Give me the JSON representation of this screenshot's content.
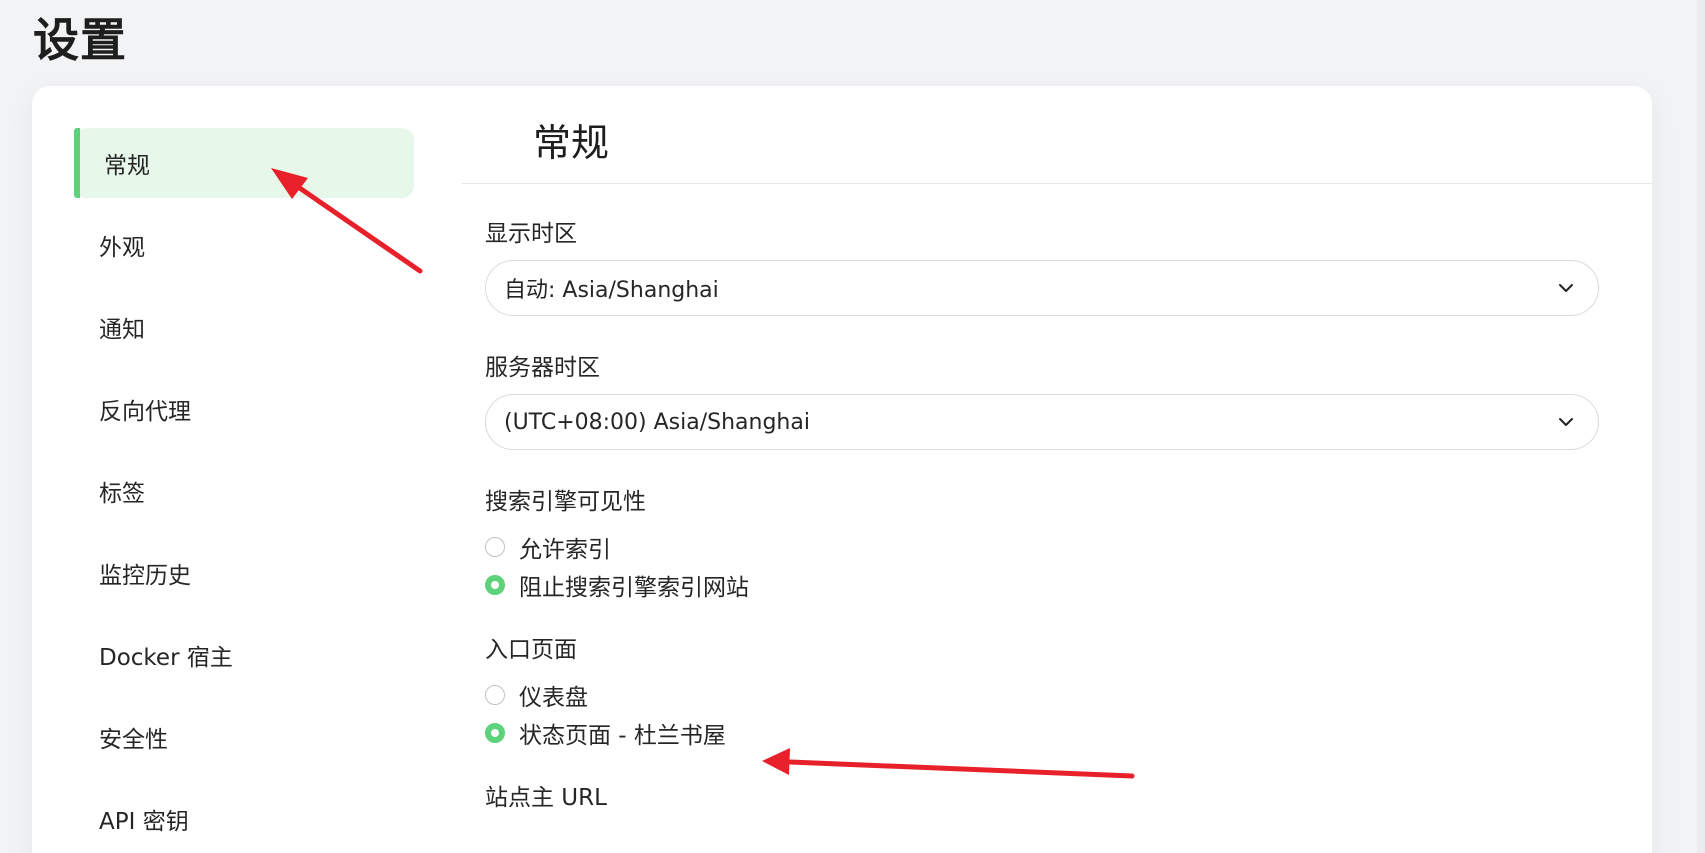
{
  "page": {
    "title": "设置"
  },
  "sidebar": {
    "items": [
      {
        "label": "常规",
        "active": true
      },
      {
        "label": "外观"
      },
      {
        "label": "通知"
      },
      {
        "label": "反向代理"
      },
      {
        "label": "标签"
      },
      {
        "label": "监控历史"
      },
      {
        "label": "Docker 宿主"
      },
      {
        "label": "安全性"
      },
      {
        "label": "API 密钥"
      }
    ]
  },
  "main": {
    "section_title": "常规",
    "display_timezone": {
      "label": "显示时区",
      "value": "自动: Asia/Shanghai",
      "icon": "chevron-down-icon"
    },
    "server_timezone": {
      "label": "服务器时区",
      "value": "(UTC+08:00) Asia/Shanghai",
      "icon": "chevron-down-icon"
    },
    "search_visibility": {
      "label": "搜索引擎可见性",
      "options": [
        {
          "label": "允许索引",
          "checked": false
        },
        {
          "label": "阻止搜索引擎索引网站",
          "checked": true
        }
      ]
    },
    "entry_page": {
      "label": "入口页面",
      "options": [
        {
          "label": "仪表盘",
          "checked": false
        },
        {
          "label": "状态页面 - 杜兰书屋",
          "checked": true
        }
      ]
    },
    "primary_url": {
      "label": "站点主 URL"
    }
  },
  "colors": {
    "accent": "#5cd27a",
    "active_bg": "#e7f8ea",
    "annotation_arrow": "#e8202a"
  }
}
